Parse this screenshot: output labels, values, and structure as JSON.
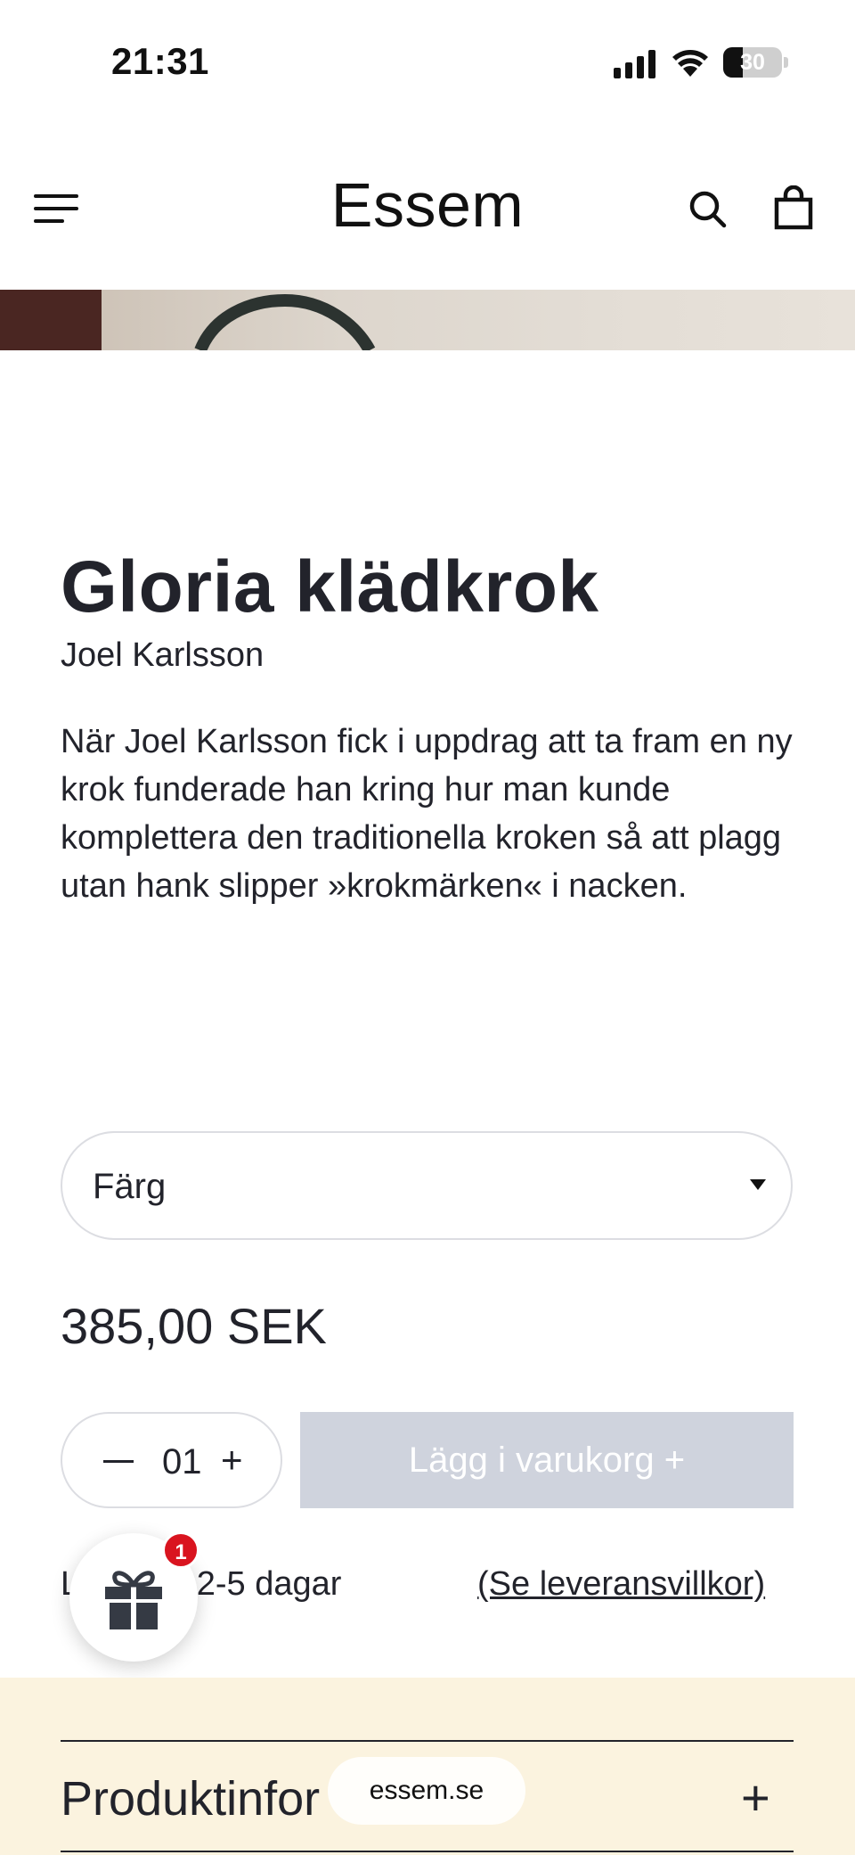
{
  "status_bar": {
    "time": "21:31",
    "battery": "30",
    "icons": [
      "signal-icon",
      "wifi-icon",
      "battery-icon"
    ]
  },
  "header": {
    "brand": "Essem",
    "icons": [
      "menu-icon",
      "search-icon",
      "bag-icon"
    ]
  },
  "product": {
    "title": "Gloria klädkrok",
    "designer": "Joel Karlsson",
    "description": "När Joel Karlsson fick i uppdrag att ta fram en ny krok funderade han kring hur man kunde komplettera den traditionella kroken så att plagg utan hank slipper »krokmärken« i nacken.",
    "color_select_label": "Färg",
    "price": "385,00 SEK",
    "quantity": "01",
    "quantity_minus": "—",
    "quantity_plus": "+",
    "add_to_cart": "Lägg i varukorg +",
    "delivery_text": "L      s inom 2-5 dagar",
    "delivery_link": "(Se leveransvillkor)"
  },
  "gift_widget": {
    "badge_count": "1",
    "icon": "gift-icon"
  },
  "accordion": {
    "title": "Produktinfor",
    "toggle": "+"
  },
  "browser": {
    "url": "essem.se"
  },
  "colors": {
    "text": "#22232b",
    "disabled_button": "#cfd3dd",
    "bottom_section": "#fbf3df",
    "badge": "#d9141f"
  }
}
